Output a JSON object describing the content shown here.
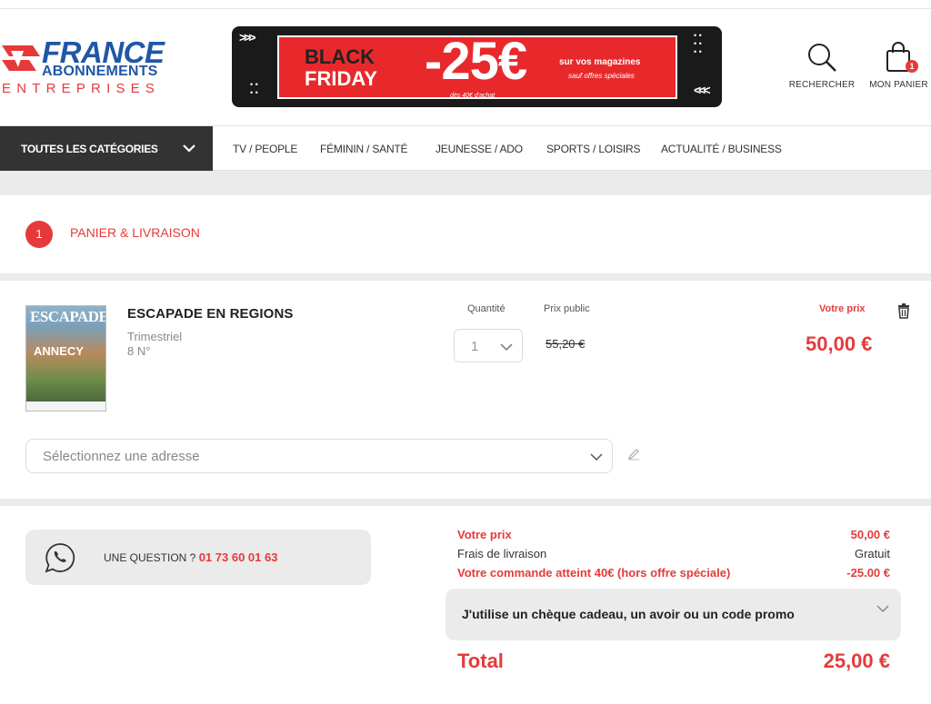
{
  "brand": {
    "line1": "FRANCE",
    "line2": "ABONNEMENTS",
    "line3": "ENTREPRISES"
  },
  "banner": {
    "arrows_left": ">>>",
    "black": "BLACK",
    "friday": "FRIDAY",
    "percent": "-25€",
    "minimum": "dès 40€ d'achat",
    "subtitle": "sur vos magazines",
    "note": "sauf offres spéciales",
    "arrows_right": "<<<"
  },
  "header": {
    "search_label": "RECHERCHER",
    "cart_label": "MON PANIER",
    "cart_count": "1"
  },
  "nav": {
    "all_categories": "TOUTES LES CATÉGORIES",
    "items": [
      "TV / PEOPLE",
      "FÉMININ / SANTÉ",
      "JEUNESSE / ADO",
      "SPORTS / LOISIRS",
      "ACTUALITÉ / BUSINESS"
    ]
  },
  "step": {
    "number": "1",
    "title": "PANIER & LIVRAISON"
  },
  "product": {
    "cover_title": "ESCAPADE",
    "cover_subtitle": "ANNECY",
    "name": "ESCAPADE EN REGIONS",
    "frequency": "Trimestriel",
    "issues": "8 N°",
    "quantity_label": "Quantité",
    "quantity_value": "1",
    "public_price_label": "Prix public",
    "public_price": "55,20 €",
    "your_price_label": "Votre prix",
    "your_price": "50,00 €",
    "address_placeholder": "Sélectionnez une adresse"
  },
  "summary": {
    "question_label": "UNE QUESTION ?",
    "phone": "01 73 60 01 63",
    "your_price_label": "Votre prix",
    "your_price_value": "50,00 €",
    "shipping_label": "Frais de livraison",
    "shipping_value": "Gratuit",
    "discount_label": "Votre commande atteint 40€ (hors offre spéciale)",
    "discount_value": "-25.00 €",
    "promo_label": "J'utilise un chèque cadeau, un avoir ou un code promo",
    "total_label": "Total",
    "total_value": "25,00 €"
  },
  "colors": {
    "accent": "#e63a3a",
    "brand_blue": "#1f57a6",
    "nav_dark": "#333333"
  }
}
